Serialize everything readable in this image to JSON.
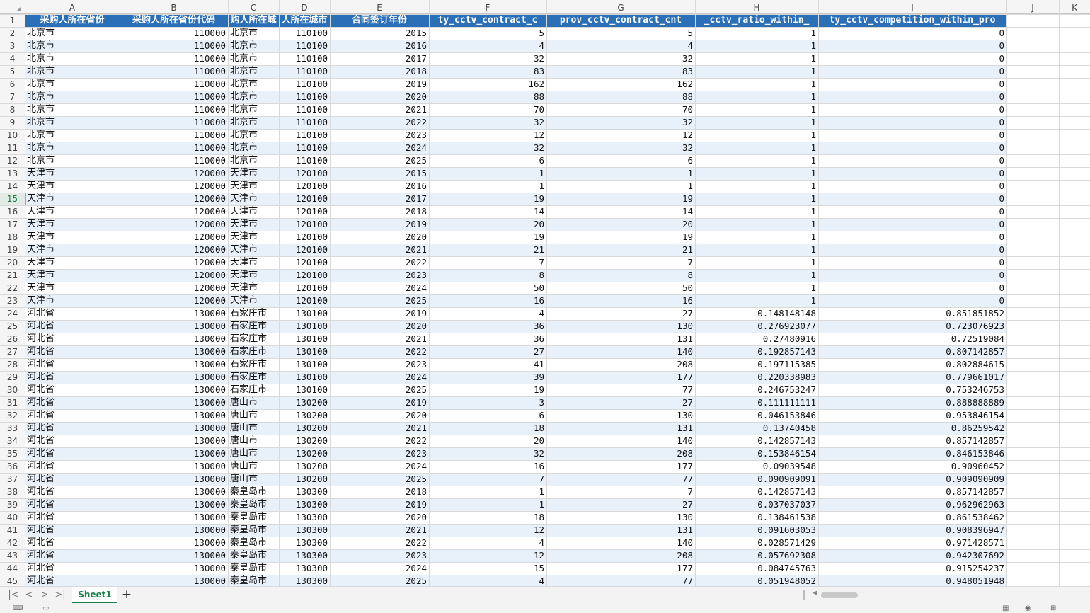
{
  "colors": {
    "header_fill": "#2b6fb6",
    "band": "#e8f0fa",
    "grid": "#d9d9d9",
    "accent": "#1a7f4b"
  },
  "column_letters": [
    "A",
    "B",
    "C",
    "D",
    "E",
    "F",
    "G",
    "H",
    "I",
    "J",
    "K"
  ],
  "headers": [
    "采购人所在省份",
    "采购人所在省份代码",
    "购人所在城",
    "人所在城市",
    "合同签订年份",
    "ty_cctv_contract_c",
    "prov_cctv_contract_cnt",
    "_cctv_ratio_within_",
    "ty_cctv_competition_within_pro"
  ],
  "rows": [
    [
      "2",
      "北京市",
      "110000",
      "北京市",
      "110100",
      "2015",
      "5",
      "5",
      "1",
      "0"
    ],
    [
      "3",
      "北京市",
      "110000",
      "北京市",
      "110100",
      "2016",
      "4",
      "4",
      "1",
      "0"
    ],
    [
      "4",
      "北京市",
      "110000",
      "北京市",
      "110100",
      "2017",
      "32",
      "32",
      "1",
      "0"
    ],
    [
      "5",
      "北京市",
      "110000",
      "北京市",
      "110100",
      "2018",
      "83",
      "83",
      "1",
      "0"
    ],
    [
      "6",
      "北京市",
      "110000",
      "北京市",
      "110100",
      "2019",
      "162",
      "162",
      "1",
      "0"
    ],
    [
      "7",
      "北京市",
      "110000",
      "北京市",
      "110100",
      "2020",
      "88",
      "88",
      "1",
      "0"
    ],
    [
      "8",
      "北京市",
      "110000",
      "北京市",
      "110100",
      "2021",
      "70",
      "70",
      "1",
      "0"
    ],
    [
      "9",
      "北京市",
      "110000",
      "北京市",
      "110100",
      "2022",
      "32",
      "32",
      "1",
      "0"
    ],
    [
      "10",
      "北京市",
      "110000",
      "北京市",
      "110100",
      "2023",
      "12",
      "12",
      "1",
      "0"
    ],
    [
      "11",
      "北京市",
      "110000",
      "北京市",
      "110100",
      "2024",
      "32",
      "32",
      "1",
      "0"
    ],
    [
      "12",
      "北京市",
      "110000",
      "北京市",
      "110100",
      "2025",
      "6",
      "6",
      "1",
      "0"
    ],
    [
      "13",
      "天津市",
      "120000",
      "天津市",
      "120100",
      "2015",
      "1",
      "1",
      "1",
      "0"
    ],
    [
      "14",
      "天津市",
      "120000",
      "天津市",
      "120100",
      "2016",
      "1",
      "1",
      "1",
      "0"
    ],
    [
      "15",
      "天津市",
      "120000",
      "天津市",
      "120100",
      "2017",
      "19",
      "19",
      "1",
      "0"
    ],
    [
      "16",
      "天津市",
      "120000",
      "天津市",
      "120100",
      "2018",
      "14",
      "14",
      "1",
      "0"
    ],
    [
      "17",
      "天津市",
      "120000",
      "天津市",
      "120100",
      "2019",
      "20",
      "20",
      "1",
      "0"
    ],
    [
      "18",
      "天津市",
      "120000",
      "天津市",
      "120100",
      "2020",
      "19",
      "19",
      "1",
      "0"
    ],
    [
      "19",
      "天津市",
      "120000",
      "天津市",
      "120100",
      "2021",
      "21",
      "21",
      "1",
      "0"
    ],
    [
      "20",
      "天津市",
      "120000",
      "天津市",
      "120100",
      "2022",
      "7",
      "7",
      "1",
      "0"
    ],
    [
      "21",
      "天津市",
      "120000",
      "天津市",
      "120100",
      "2023",
      "8",
      "8",
      "1",
      "0"
    ],
    [
      "22",
      "天津市",
      "120000",
      "天津市",
      "120100",
      "2024",
      "50",
      "50",
      "1",
      "0"
    ],
    [
      "23",
      "天津市",
      "120000",
      "天津市",
      "120100",
      "2025",
      "16",
      "16",
      "1",
      "0"
    ],
    [
      "24",
      "河北省",
      "130000",
      "石家庄市",
      "130100",
      "2019",
      "4",
      "27",
      "0.148148148",
      "0.851851852"
    ],
    [
      "25",
      "河北省",
      "130000",
      "石家庄市",
      "130100",
      "2020",
      "36",
      "130",
      "0.276923077",
      "0.723076923"
    ],
    [
      "26",
      "河北省",
      "130000",
      "石家庄市",
      "130100",
      "2021",
      "36",
      "131",
      "0.27480916",
      "0.72519084"
    ],
    [
      "27",
      "河北省",
      "130000",
      "石家庄市",
      "130100",
      "2022",
      "27",
      "140",
      "0.192857143",
      "0.807142857"
    ],
    [
      "28",
      "河北省",
      "130000",
      "石家庄市",
      "130100",
      "2023",
      "41",
      "208",
      "0.197115385",
      "0.802884615"
    ],
    [
      "29",
      "河北省",
      "130000",
      "石家庄市",
      "130100",
      "2024",
      "39",
      "177",
      "0.220338983",
      "0.779661017"
    ],
    [
      "30",
      "河北省",
      "130000",
      "石家庄市",
      "130100",
      "2025",
      "19",
      "77",
      "0.246753247",
      "0.753246753"
    ],
    [
      "31",
      "河北省",
      "130000",
      "唐山市",
      "130200",
      "2019",
      "3",
      "27",
      "0.111111111",
      "0.888888889"
    ],
    [
      "32",
      "河北省",
      "130000",
      "唐山市",
      "130200",
      "2020",
      "6",
      "130",
      "0.046153846",
      "0.953846154"
    ],
    [
      "33",
      "河北省",
      "130000",
      "唐山市",
      "130200",
      "2021",
      "18",
      "131",
      "0.13740458",
      "0.86259542"
    ],
    [
      "34",
      "河北省",
      "130000",
      "唐山市",
      "130200",
      "2022",
      "20",
      "140",
      "0.142857143",
      "0.857142857"
    ],
    [
      "35",
      "河北省",
      "130000",
      "唐山市",
      "130200",
      "2023",
      "32",
      "208",
      "0.153846154",
      "0.846153846"
    ],
    [
      "36",
      "河北省",
      "130000",
      "唐山市",
      "130200",
      "2024",
      "16",
      "177",
      "0.09039548",
      "0.90960452"
    ],
    [
      "37",
      "河北省",
      "130000",
      "唐山市",
      "130200",
      "2025",
      "7",
      "77",
      "0.090909091",
      "0.909090909"
    ],
    [
      "38",
      "河北省",
      "130000",
      "秦皇岛市",
      "130300",
      "2018",
      "1",
      "7",
      "0.142857143",
      "0.857142857"
    ],
    [
      "39",
      "河北省",
      "130000",
      "秦皇岛市",
      "130300",
      "2019",
      "1",
      "27",
      "0.037037037",
      "0.962962963"
    ],
    [
      "40",
      "河北省",
      "130000",
      "秦皇岛市",
      "130300",
      "2020",
      "18",
      "130",
      "0.138461538",
      "0.861538462"
    ],
    [
      "41",
      "河北省",
      "130000",
      "秦皇岛市",
      "130300",
      "2021",
      "12",
      "131",
      "0.091603053",
      "0.908396947"
    ],
    [
      "42",
      "河北省",
      "130000",
      "秦皇岛市",
      "130300",
      "2022",
      "4",
      "140",
      "0.028571429",
      "0.971428571"
    ],
    [
      "43",
      "河北省",
      "130000",
      "秦皇岛市",
      "130300",
      "2023",
      "12",
      "208",
      "0.057692308",
      "0.942307692"
    ],
    [
      "44",
      "河北省",
      "130000",
      "秦皇岛市",
      "130300",
      "2024",
      "15",
      "177",
      "0.084745763",
      "0.915254237"
    ],
    [
      "45",
      "河北省",
      "130000",
      "秦皇岛市",
      "130300",
      "2025",
      "4",
      "77",
      "0.051948052",
      "0.948051948"
    ]
  ],
  "tabs": {
    "sheet_name": "Sheet1",
    "add": "+"
  },
  "nav": {
    "first": "|<",
    "prev": "<",
    "next": ">",
    "last": ">|"
  }
}
